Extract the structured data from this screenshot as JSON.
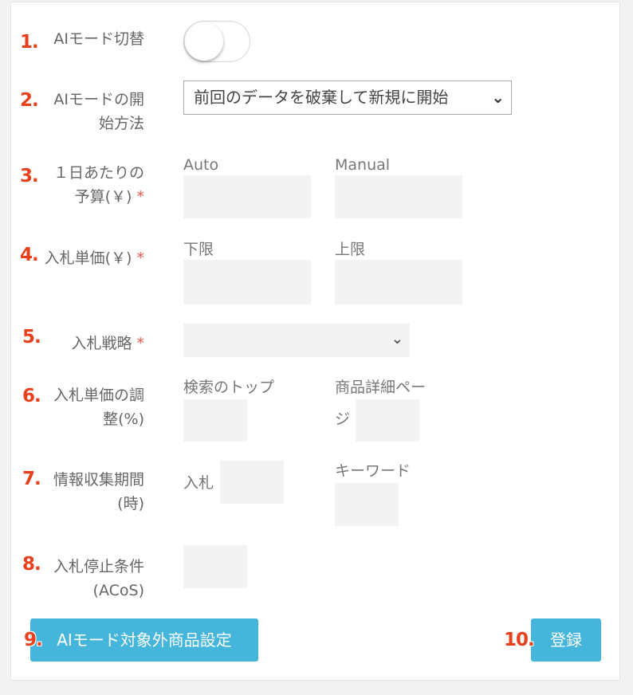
{
  "fields": {
    "ai_mode": {
      "num": "1.",
      "label": "AIモード切替",
      "toggle_state": "off"
    },
    "ai_start": {
      "num": "2.",
      "label_line1": "AIモードの開",
      "label_line2": "始方法",
      "selected": "前回のデータを破棄して新規に開始"
    },
    "daily_budget": {
      "num": "3.",
      "label_line1": "１日あたりの",
      "label_line2": "予算(￥)",
      "required": "*",
      "sub1": "Auto",
      "sub2": "Manual"
    },
    "bid_price": {
      "num": "4.",
      "label": "入札単価(￥)",
      "required": "*",
      "sub1": "下限",
      "sub2": "上限"
    },
    "bid_strategy": {
      "num": "5.",
      "label": "入札戦略",
      "required": "*"
    },
    "bid_adjust": {
      "num": "6.",
      "label_line1": "入札単価の調",
      "label_line2": "整(%)",
      "sub1": "検索のトップ",
      "sub2_line1": "商品詳細ペー",
      "sub2_line2": "ジ"
    },
    "collect_period": {
      "num": "7.",
      "label_line1": "情報収集期間",
      "label_line2": "(時)",
      "sub1": "入札",
      "sub2": "キーワード"
    },
    "bid_stop": {
      "num": "8.",
      "label_line1": "入札停止条件",
      "label_line2": "(ACoS)"
    }
  },
  "buttons": {
    "exclude": {
      "num": "9.",
      "label": "AIモード対象外商品設定"
    },
    "register": {
      "num": "10.",
      "label": "登録"
    }
  },
  "colors": {
    "accent": "#45b5dc",
    "number": "#e8401c",
    "required": "#e05a4f"
  }
}
